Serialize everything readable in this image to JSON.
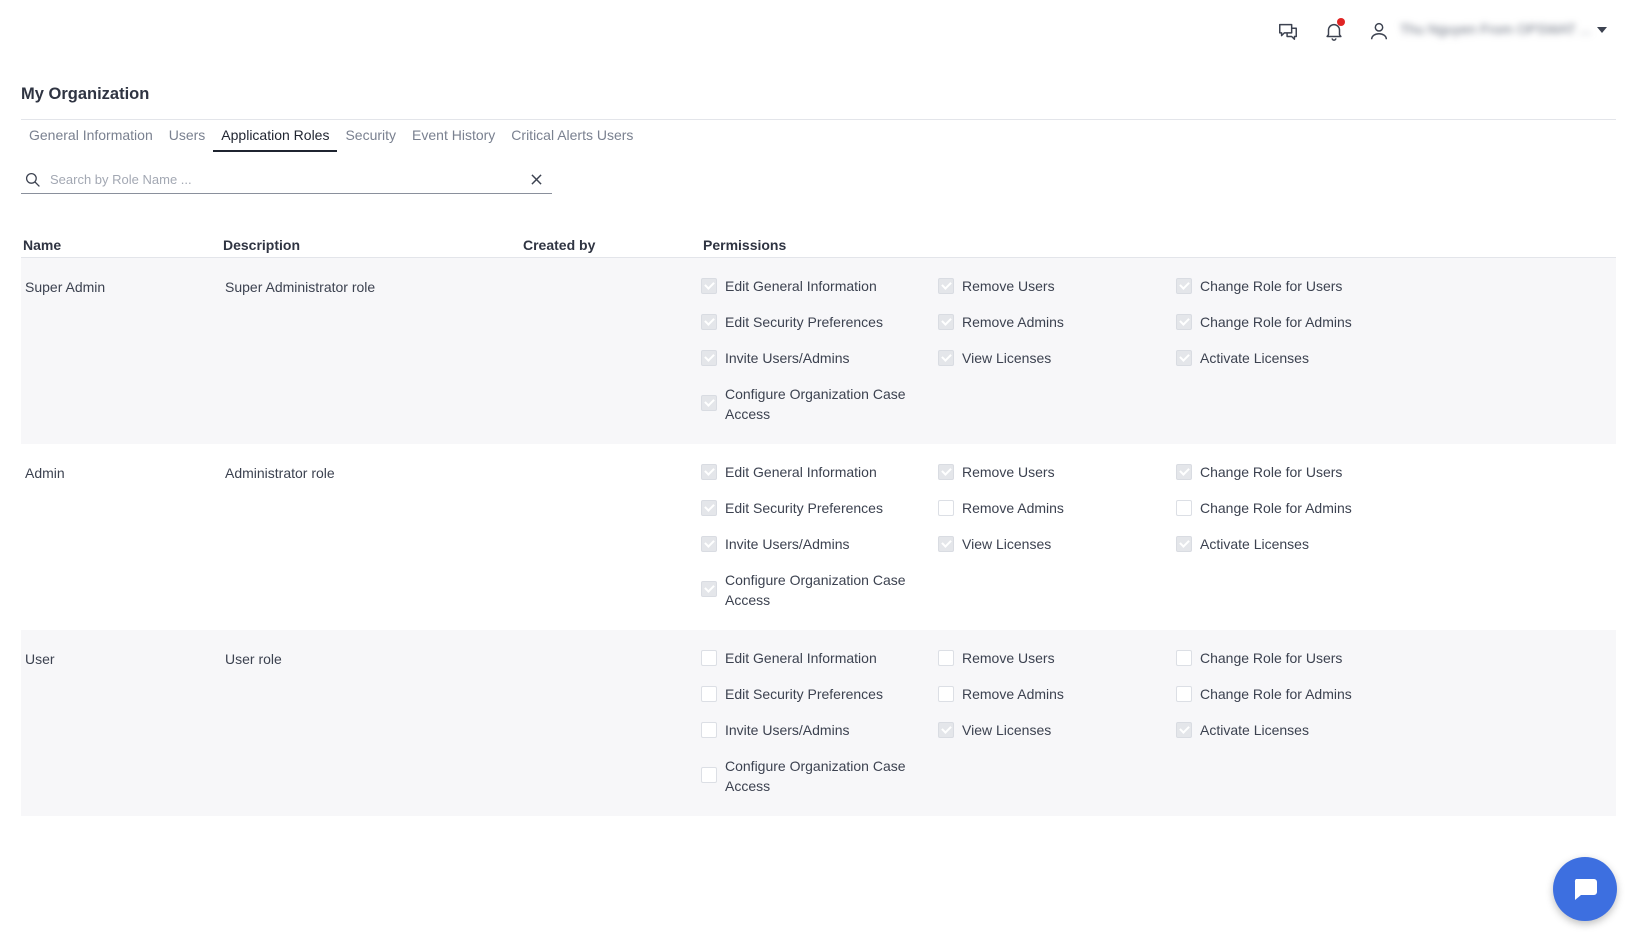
{
  "header": {
    "messages_icon": "chat-bubbles-icon",
    "notifications_icon": "bell-icon",
    "user_icon": "person-icon",
    "user_name": "Thu Nguyen From OPSWAT ...",
    "notification_dot_color": "#e02424"
  },
  "page": {
    "title": "My Organization"
  },
  "tabs": [
    {
      "label": "General Information",
      "active": false
    },
    {
      "label": "Users",
      "active": false
    },
    {
      "label": "Application Roles",
      "active": true
    },
    {
      "label": "Security",
      "active": false
    },
    {
      "label": "Event History",
      "active": false
    },
    {
      "label": "Critical Alerts Users",
      "active": false
    }
  ],
  "search": {
    "placeholder": "Search by Role Name ...",
    "value": ""
  },
  "table": {
    "columns": {
      "name": "Name",
      "description": "Description",
      "created_by": "Created by",
      "permissions": "Permissions"
    },
    "permission_labels": [
      "Edit General Information",
      "Remove Users",
      "Change Role for Users",
      "Edit Security Preferences",
      "Remove Admins",
      "Change Role for Admins",
      "Invite Users/Admins",
      "View Licenses",
      "Activate Licenses",
      "Configure Organization Case Access"
    ],
    "rows": [
      {
        "name": "Super Admin",
        "description": "Super Administrator role",
        "created_by": "",
        "permissions": [
          true,
          true,
          true,
          true,
          true,
          true,
          true,
          true,
          true,
          true
        ]
      },
      {
        "name": "Admin",
        "description": "Administrator role",
        "created_by": "",
        "permissions": [
          true,
          true,
          true,
          true,
          false,
          false,
          true,
          true,
          true,
          true
        ]
      },
      {
        "name": "User",
        "description": "User role",
        "created_by": "",
        "permissions": [
          false,
          false,
          false,
          false,
          false,
          false,
          false,
          true,
          true,
          false
        ]
      }
    ]
  },
  "chat_fab": {
    "icon": "chat-icon",
    "color": "#3d6fe0"
  }
}
